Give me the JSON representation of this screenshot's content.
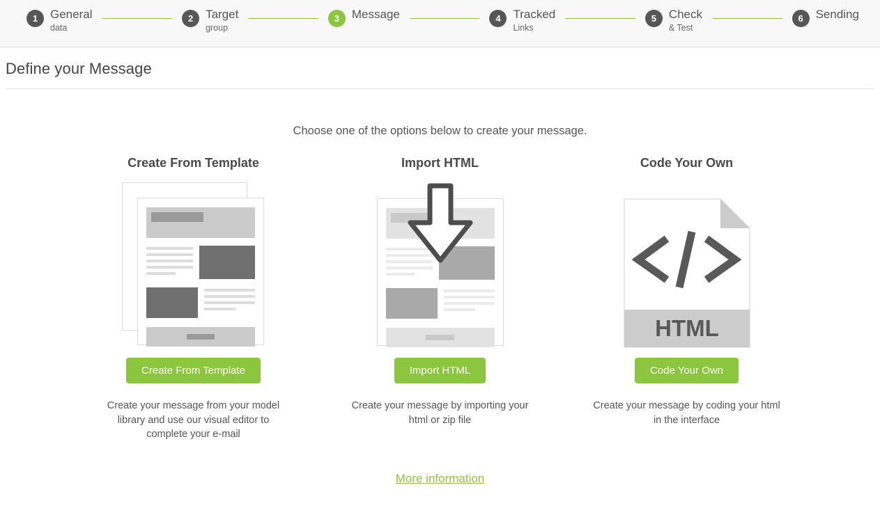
{
  "stepper": {
    "steps": [
      {
        "num": "1",
        "title": "General",
        "sub": "data",
        "active": false
      },
      {
        "num": "2",
        "title": "Target",
        "sub": "group",
        "active": false
      },
      {
        "num": "3",
        "title": "Message",
        "sub": "",
        "active": true
      },
      {
        "num": "4",
        "title": "Tracked",
        "sub": "Links",
        "active": false
      },
      {
        "num": "5",
        "title": "Check",
        "sub": "& Test",
        "active": false
      },
      {
        "num": "6",
        "title": "Sending",
        "sub": "",
        "active": false
      }
    ]
  },
  "page": {
    "title": "Define your Message",
    "intro": "Choose one of the options below to create your message."
  },
  "options": [
    {
      "heading": "Create From Template",
      "button": "Create From Template",
      "description": "Create your message from your model library and use our visual editor to complete your e-mail",
      "icon": "document-stack-icon"
    },
    {
      "heading": "Import HTML",
      "button": "Import HTML",
      "description": "Create your message by importing your html or zip file",
      "icon": "download-arrow-document-icon"
    },
    {
      "heading": "Code Your Own",
      "button": "Code Your Own",
      "description": "Create your message by coding your html in the interface",
      "icon": "html-file-icon",
      "file_label": "HTML"
    }
  ],
  "footer": {
    "more_information": "More information"
  },
  "colors": {
    "accent_green": "#8cc63e",
    "badge_gray": "#575757",
    "header_bg": "#f8f8f8",
    "text_gray": "#555555"
  }
}
